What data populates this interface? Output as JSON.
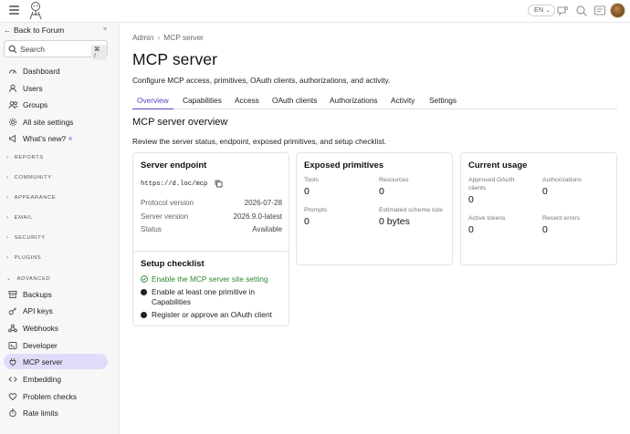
{
  "header": {
    "lang": "EN",
    "colors": {
      "accent": "#5545c9",
      "success": "#2a8a30"
    }
  },
  "sidebar": {
    "back_label": "Back to Forum",
    "search_placeholder": "Search",
    "search_shortcut": "⌘ /",
    "top_items": [
      {
        "label": "Dashboard",
        "icon": "gauge-icon"
      },
      {
        "label": "Users",
        "icon": "user-icon"
      },
      {
        "label": "Groups",
        "icon": "users-icon"
      },
      {
        "label": "All site settings",
        "icon": "gear-icon"
      },
      {
        "label": "What's new?",
        "icon": "megaphone-icon"
      }
    ],
    "sections": [
      "REPORTS",
      "COMMUNITY",
      "APPEARANCE",
      "EMAIL",
      "SECURITY",
      "PLUGINS",
      "ADVANCED"
    ],
    "advanced_items": [
      {
        "label": "Backups",
        "icon": "archive-icon"
      },
      {
        "label": "API keys",
        "icon": "key-icon"
      },
      {
        "label": "Webhooks",
        "icon": "webhook-icon"
      },
      {
        "label": "Developer",
        "icon": "terminal-icon"
      },
      {
        "label": "MCP server",
        "icon": "plug-icon"
      },
      {
        "label": "Embedding",
        "icon": "code-icon"
      },
      {
        "label": "Problem checks",
        "icon": "heart-icon"
      },
      {
        "label": "Rate limits",
        "icon": "timer-icon"
      }
    ]
  },
  "main": {
    "breadcrumb": [
      "Admin",
      "MCP server"
    ],
    "title": "MCP server",
    "subtitle": "Configure MCP access, primitives, OAuth clients, authorizations, and activity.",
    "tabs": [
      "Overview",
      "Capabilities",
      "Access",
      "OAuth clients",
      "Authorizations",
      "Activity",
      "Settings"
    ],
    "active_tab": "Overview",
    "overview_title": "MCP server overview",
    "overview_desc": "Review the server status, endpoint, exposed primitives, and setup checklist.",
    "endpoint_card": {
      "title": "Server endpoint",
      "url": "https://d.loc/mcp",
      "rows": [
        {
          "key": "Protocol version",
          "value": "2026-07-28"
        },
        {
          "key": "Server version",
          "value": "2026.9.0-latest"
        },
        {
          "key": "Status",
          "value": "Available"
        }
      ]
    },
    "primitives_card": {
      "title": "Exposed primitives",
      "metrics": [
        {
          "label": "Tools",
          "value": "0"
        },
        {
          "label": "Resources",
          "value": "0"
        },
        {
          "label": "Prompts",
          "value": "0"
        },
        {
          "label": "Estimated schema size",
          "value": "0 bytes"
        }
      ]
    },
    "usage_card": {
      "title": "Current usage",
      "metrics": [
        {
          "label": "Approved OAuth clients",
          "value": "0"
        },
        {
          "label": "Authorizations",
          "value": "0"
        },
        {
          "label": "Active tokens",
          "value": "0"
        },
        {
          "label": "Recent errors",
          "value": "0"
        }
      ]
    },
    "checklist_card": {
      "title": "Setup checklist",
      "items": [
        {
          "label": "Enable the MCP server site setting",
          "done": true
        },
        {
          "label": "Enable at least one primitive in Capabilities",
          "done": false
        },
        {
          "label": "Register or approve an OAuth client",
          "done": false
        }
      ]
    }
  }
}
